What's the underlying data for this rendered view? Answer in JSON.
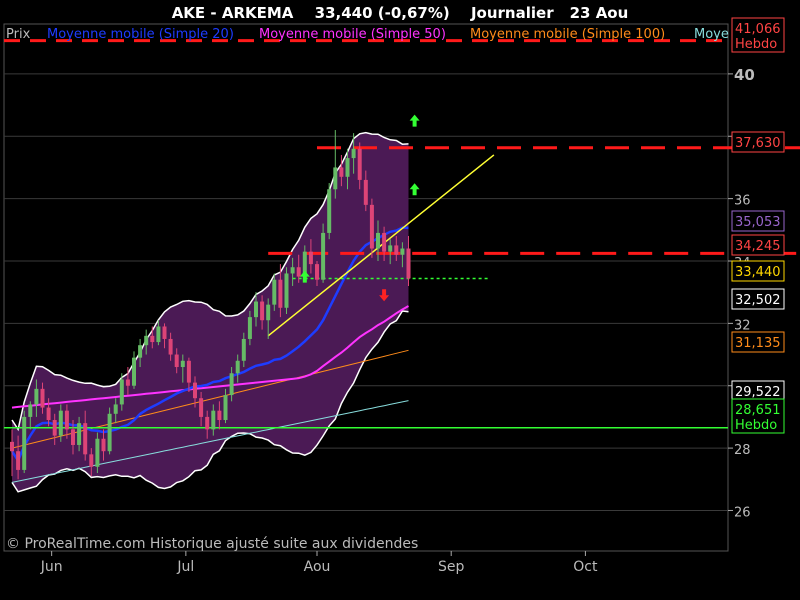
{
  "header": {
    "symbol": "AKE - ARKEMA",
    "price_change": "33,440 (-0,67%)",
    "period": "Journalier",
    "date": "23 Aou"
  },
  "legend": {
    "price": "Prix",
    "ma20": "Moyenne mobile (Simple 20)",
    "ma50": "Moyenne mobile (Simple 50)",
    "ma100": "Moyenne mobile (Simple 100)",
    "ma_truncated": "Moye"
  },
  "footer": {
    "copyright": "© ProRealTime.com Historique ajusté suite aux dividendes"
  },
  "colors": {
    "background": "#000000",
    "bollinger_fill": "#4b1a55",
    "bollinger_border": "#ffffff",
    "ma20": "#1e3cff",
    "ma50": "#ff33ff",
    "ma100": "#ff8c1a",
    "ma_long": "#88dddd",
    "resistance": "#ff1a1a",
    "support_line": "#33ff33",
    "trendline": "#ffff33",
    "candle_up": "#66bb66",
    "candle_down": "#dd4477",
    "grid": "#3a3a3a"
  },
  "chart_data": {
    "type": "candlestick",
    "x_labels": [
      "Jun",
      "Jul",
      "Aou",
      "Sep",
      "Oct"
    ],
    "ylim": [
      24.7,
      41.6
    ],
    "y_ticks": [
      26,
      28,
      30,
      32,
      34,
      36,
      38,
      40
    ],
    "bold_ticks": [
      30,
      40
    ],
    "ohlc": [
      [
        28.2,
        28.6,
        27.1,
        27.9
      ],
      [
        27.9,
        28.4,
        27.0,
        27.3
      ],
      [
        27.3,
        29.2,
        27.2,
        29.0
      ],
      [
        29.0,
        29.5,
        28.6,
        29.4
      ],
      [
        29.4,
        30.2,
        29.0,
        29.9
      ],
      [
        29.9,
        30.1,
        29.1,
        29.3
      ],
      [
        29.3,
        29.6,
        28.7,
        28.9
      ],
      [
        28.9,
        29.1,
        28.1,
        28.4
      ],
      [
        28.4,
        29.4,
        28.2,
        29.2
      ],
      [
        29.2,
        29.4,
        28.3,
        28.6
      ],
      [
        28.6,
        28.9,
        27.8,
        28.1
      ],
      [
        28.1,
        29.0,
        27.9,
        28.8
      ],
      [
        28.8,
        29.2,
        27.6,
        27.8
      ],
      [
        27.8,
        28.0,
        27.1,
        27.4
      ],
      [
        27.4,
        28.5,
        27.2,
        28.3
      ],
      [
        28.3,
        28.6,
        27.6,
        27.9
      ],
      [
        27.9,
        29.3,
        27.8,
        29.1
      ],
      [
        29.1,
        29.6,
        28.8,
        29.4
      ],
      [
        29.4,
        30.4,
        29.2,
        30.2
      ],
      [
        30.2,
        30.6,
        29.7,
        30.0
      ],
      [
        30.0,
        31.1,
        29.9,
        30.9
      ],
      [
        30.9,
        31.5,
        30.6,
        31.3
      ],
      [
        31.3,
        31.8,
        31.0,
        31.6
      ],
      [
        31.6,
        31.9,
        31.2,
        31.4
      ],
      [
        31.4,
        32.1,
        31.3,
        31.9
      ],
      [
        31.9,
        32.0,
        31.2,
        31.5
      ],
      [
        31.5,
        31.7,
        30.8,
        31.0
      ],
      [
        31.0,
        31.2,
        30.4,
        30.6
      ],
      [
        30.6,
        31.0,
        30.1,
        30.8
      ],
      [
        30.8,
        30.9,
        29.8,
        30.1
      ],
      [
        30.1,
        30.3,
        29.3,
        29.6
      ],
      [
        29.6,
        29.8,
        28.7,
        29.0
      ],
      [
        29.0,
        29.2,
        28.3,
        28.6
      ],
      [
        28.6,
        29.4,
        28.4,
        29.2
      ],
      [
        29.2,
        29.5,
        28.6,
        28.9
      ],
      [
        28.9,
        29.9,
        28.8,
        29.7
      ],
      [
        29.7,
        30.6,
        29.5,
        30.4
      ],
      [
        30.4,
        31.0,
        30.1,
        30.8
      ],
      [
        30.8,
        31.7,
        30.6,
        31.5
      ],
      [
        31.5,
        32.4,
        31.3,
        32.2
      ],
      [
        32.2,
        33.0,
        31.9,
        32.7
      ],
      [
        32.7,
        32.9,
        31.8,
        32.1
      ],
      [
        32.1,
        32.8,
        31.5,
        32.6
      ],
      [
        32.6,
        33.6,
        32.4,
        33.4
      ],
      [
        33.4,
        33.9,
        32.2,
        32.5
      ],
      [
        32.5,
        33.8,
        32.3,
        33.6
      ],
      [
        33.6,
        34.1,
        33.2,
        33.8
      ],
      [
        33.8,
        34.2,
        33.3,
        33.5
      ],
      [
        33.5,
        34.5,
        33.4,
        34.3
      ],
      [
        34.3,
        34.7,
        33.6,
        33.9
      ],
      [
        33.9,
        34.0,
        33.2,
        33.4
      ],
      [
        33.4,
        35.2,
        33.3,
        34.9
      ],
      [
        34.9,
        36.5,
        34.7,
        36.3
      ],
      [
        36.3,
        38.2,
        36.0,
        37.0
      ],
      [
        37.0,
        37.4,
        36.4,
        36.7
      ],
      [
        36.7,
        37.6,
        36.3,
        37.3
      ],
      [
        37.3,
        38.1,
        36.8,
        37.6
      ],
      [
        37.6,
        37.8,
        36.3,
        36.6
      ],
      [
        36.6,
        36.9,
        35.6,
        35.8
      ],
      [
        35.8,
        36.0,
        34.1,
        34.4
      ],
      [
        34.4,
        35.3,
        34.0,
        34.9
      ],
      [
        34.9,
        35.1,
        34.0,
        34.3
      ],
      [
        34.3,
        34.7,
        33.9,
        34.5
      ],
      [
        34.5,
        34.8,
        34.0,
        34.2
      ],
      [
        34.2,
        34.6,
        33.8,
        34.4
      ],
      [
        34.4,
        34.8,
        33.2,
        33.44
      ]
    ],
    "current_price": 33.44,
    "price_labels": [
      {
        "value": "41,066",
        "sub": "Hebdo",
        "color": "#ff4444"
      },
      {
        "value": "37,630",
        "color": "#ff4444"
      },
      {
        "value": "35,053",
        "color": "#9966cc"
      },
      {
        "value": "34,245",
        "color": "#ff4444"
      },
      {
        "value": "33,440",
        "color": "#ffd700"
      },
      {
        "value": "32,502",
        "color": "#ffffff"
      },
      {
        "value": "31,135",
        "color": "#ff8c1a"
      },
      {
        "value": "29,522",
        "color": "#ffffff"
      },
      {
        "value": "28,651",
        "sub": "Hebdo",
        "color": "#33ff33"
      }
    ],
    "levels": {
      "weekly_resistance": 41.066,
      "resistance_1": 37.63,
      "resistance_2": 34.245,
      "bb_mid": 35.053,
      "bb_lower": 32.502,
      "ma100": 31.135,
      "ma_long": 29.522,
      "weekly_support": 28.651
    }
  }
}
